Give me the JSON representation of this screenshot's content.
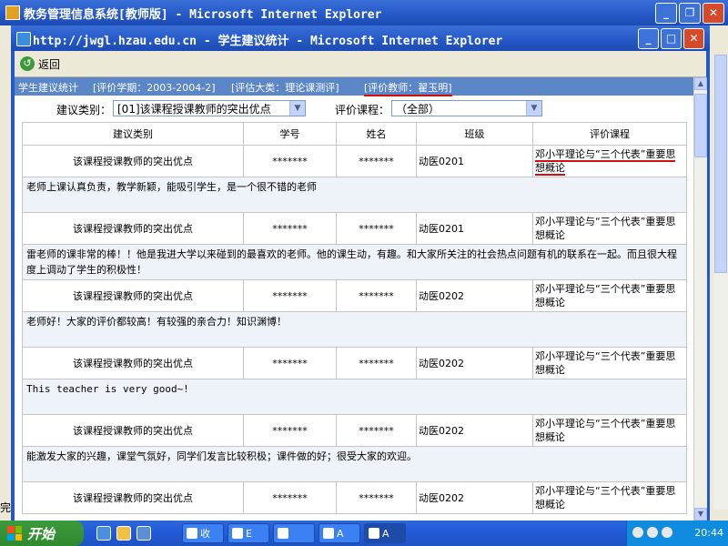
{
  "outer_window": {
    "title": "教务管理信息系统[教师版] - Microsoft Internet Explorer",
    "status_text": "完"
  },
  "popup": {
    "title": "http://jwgl.hzau.edu.cn - 学生建议统计 - Microsoft Internet Explorer",
    "back_label": "返回"
  },
  "breadcrumb": {
    "items": [
      "学生建议统计",
      "[评价学期：2003-2004-2]",
      "[评估大类：理论课测评]",
      "[评价教师：翟玉明]"
    ]
  },
  "filters": {
    "category_label": "建议类别：",
    "category_value": "[01]该课程授课教师的突出优点",
    "course_label": "评价课程：",
    "course_value": "（全部）"
  },
  "table": {
    "headers": [
      "建议类别",
      "学号",
      "姓名",
      "班级",
      "评价课程"
    ],
    "records": [
      {
        "category": "该课程授课教师的突出优点",
        "student_id": "*******",
        "name": "*******",
        "class": "动医0201",
        "course": "邓小平理论与“三个代表”重要思想概论",
        "comment": "老师上课认真负责，教学新颖，能吸引学生，是一个很不错的老师"
      },
      {
        "category": "该课程授课教师的突出优点",
        "student_id": "*******",
        "name": "*******",
        "class": "动医0201",
        "course": "邓小平理论与“三个代表”重要思想概论",
        "comment": "雷老师的课非常的棒！！他是我进大学以来碰到的最喜欢的老师。他的课生动，有趣。和大家所关注的社会热点问题有机的联系在一起。而且很大程度上调动了学生的积极性！"
      },
      {
        "category": "该课程授课教师的突出优点",
        "student_id": "*******",
        "name": "*******",
        "class": "动医0202",
        "course": "邓小平理论与“三个代表”重要思想概论",
        "comment": "老师好！大家的评价都较高！有较强的亲合力！知识渊博！"
      },
      {
        "category": "该课程授课教师的突出优点",
        "student_id": "*******",
        "name": "*******",
        "class": "动医0202",
        "course": "邓小平理论与“三个代表”重要思想概论",
        "comment": "This teacher is very good~!"
      },
      {
        "category": "该课程授课教师的突出优点",
        "student_id": "*******",
        "name": "*******",
        "class": "动医0202",
        "course": "邓小平理论与“三个代表”重要思想概论",
        "comment": "能激发大家的兴趣，课堂气氛好，同学们发言比较积极；课件做的好；很受大家的欢迎。"
      },
      {
        "category": "该课程授课教师的突出优点",
        "student_id": "*******",
        "name": "*******",
        "class": "动医0202",
        "course": "邓小平理论与“三个代表”重要思想概论",
        "comment": ""
      }
    ]
  },
  "taskbar": {
    "start_label": "开始",
    "tasks": [
      "收",
      "E",
      "",
      "A",
      "A"
    ],
    "clock": "20:44"
  },
  "colors": {
    "titlebar": "#2458c6",
    "breadcrumb_bg": "#5b87c8",
    "underline": "#d01010",
    "comment_bg": "#eef3f9"
  }
}
